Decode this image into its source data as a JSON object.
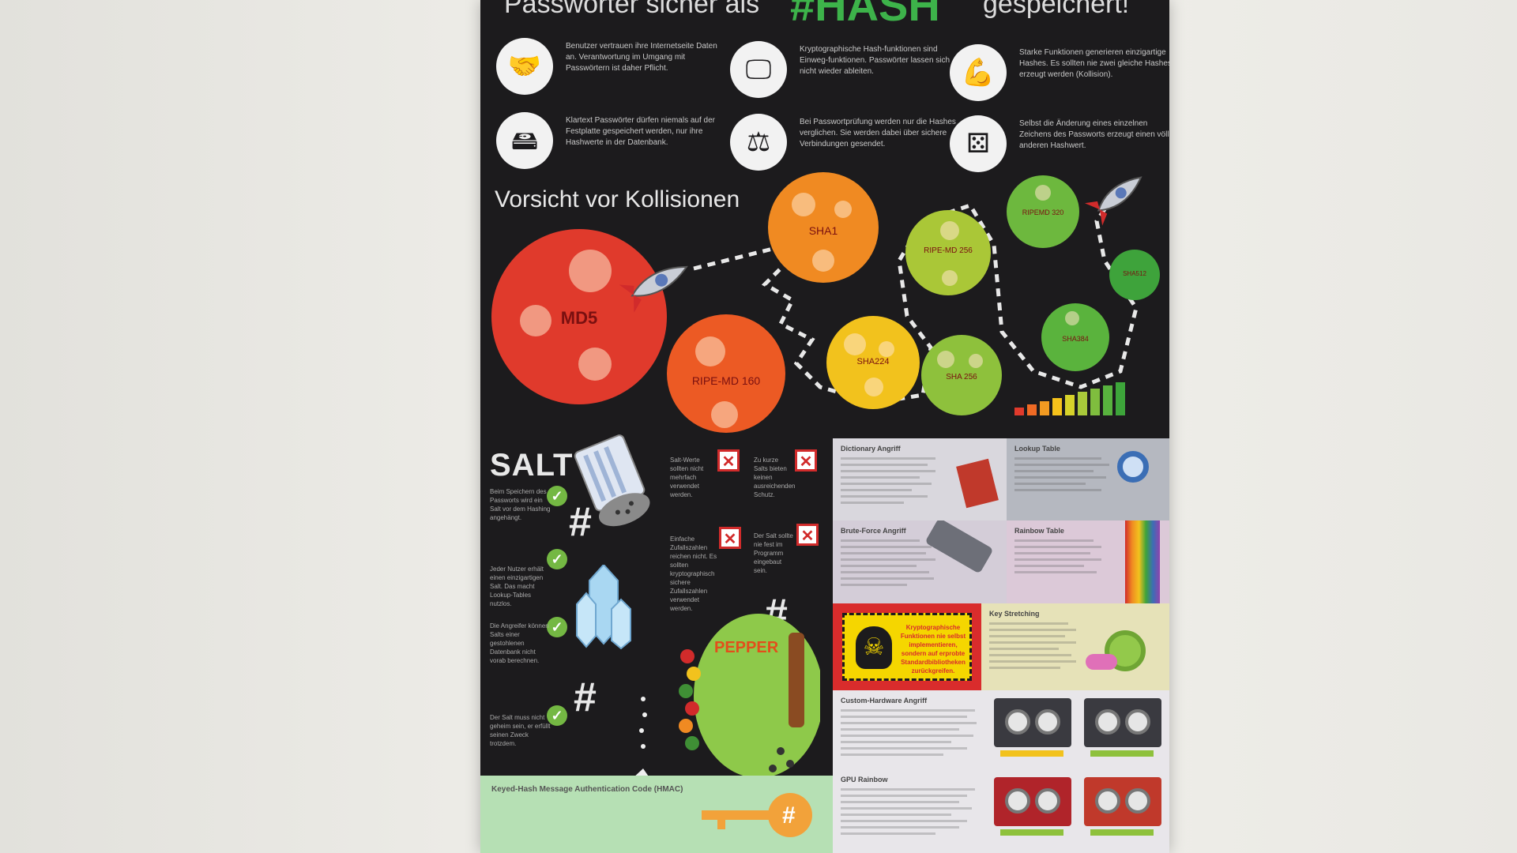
{
  "title": {
    "part1": "Passwörter sicher als",
    "part2": "#HASH",
    "part3": "gespeichert!"
  },
  "facts": [
    {
      "icon": "handshake-icon",
      "glyph": "🤝",
      "text": "Benutzer vertrauen ihre Internetseite Daten an. Verantwortung im Umgang mit Passwörtern ist daher Pflicht."
    },
    {
      "icon": "monitor-icon",
      "glyph": "🖵",
      "text": "Kryptographische Hash-funktionen sind Einweg-funktionen. Passwörter lassen sich nicht wieder ableiten."
    },
    {
      "icon": "muscle-icon",
      "glyph": "💪",
      "text": "Starke Funktionen generieren einzigartige Hashes. Es sollten nie zwei gleiche Hashes erzeugt werden (Kollision)."
    },
    {
      "icon": "harddrive-icon",
      "glyph": "🖴",
      "text": "Klartext Passwörter dürfen niemals auf der Festplatte gespeichert werden, nur ihre Hashwerte in der Datenbank."
    },
    {
      "icon": "scales-icon",
      "glyph": "⚖",
      "text": "Bei Passwortprüfung werden nur die Hashes verglichen. Sie werden dabei über sichere Verbindungen gesendet."
    },
    {
      "icon": "domino-icon",
      "glyph": "⚄",
      "text": "Selbst die Änderung eines einzelnen Zeichens des Passworts erzeugt einen völlig anderen Hashwert."
    }
  ],
  "collisions": {
    "heading": "Vorsicht vor Kollisionen",
    "blobs": [
      "MD5",
      "RIPE-MD 160",
      "SHA1",
      "SHA224",
      "RIPE-MD 256",
      "SHA 256",
      "RIPEMD 320",
      "SHA384",
      "SHA512"
    ]
  },
  "salt": {
    "heading": "SALT",
    "pepper_heading": "PEPPER",
    "pros": [
      "Beim Speichern des Passworts wird ein Salt vor dem Hashing angehängt.",
      "Jeder Nutzer erhält einen einzigartigen Salt. Das macht Lookup-Tables nutzlos.",
      "Die Angreifer können Salts einer gestohlenen Datenbank nicht vorab berechnen.",
      "Der Salt muss nicht geheim sein, er erfüllt seinen Zweck trotzdem."
    ],
    "cons": [
      "Salt-Werte sollten nicht mehrfach verwendet werden.",
      "Zu kurze Salts bieten keinen ausreichenden Schutz.",
      "Einfache Zufallszahlen reichen nicht. Es sollten kryptographisch sichere Zufallszahlen verwendet werden.",
      "Der Salt sollte nie fest im Programm eingebaut sein."
    ],
    "hmac_title": "Keyed-Hash Message Authentication Code (HMAC)"
  },
  "attacks": [
    {
      "id": "dictionary",
      "title": "Dictionary Angriff",
      "color": "#d9d7dd"
    },
    {
      "id": "lookup",
      "title": "Lookup Table",
      "color": "#b5b8c0"
    },
    {
      "id": "bruteforce",
      "title": "Brute-Force Angriff",
      "color": "#d4cdd8"
    },
    {
      "id": "rainbow",
      "title": "Rainbow Table",
      "color": "#dcc9d8"
    },
    {
      "id": "slow",
      "title": "Key Stretching",
      "color": "#e6e2b8"
    },
    {
      "id": "custom",
      "title": "Custom-Hardware Angriff",
      "color": "#e8e6ea"
    },
    {
      "id": "gpu",
      "title": "GPU Rainbow",
      "color": "#e8e6ea"
    }
  ],
  "warning": "Kryptographische Funktionen nie selbst implementieren, sondern auf erprobte Standardbibliotheken zurückgreifen.",
  "colors": {
    "poster_bg": "#1c1b1d",
    "hash_green": "#3db34a",
    "md5_red": "#e03a2c",
    "warn_red": "#d92c2c",
    "warn_yellow": "#f5d600"
  }
}
